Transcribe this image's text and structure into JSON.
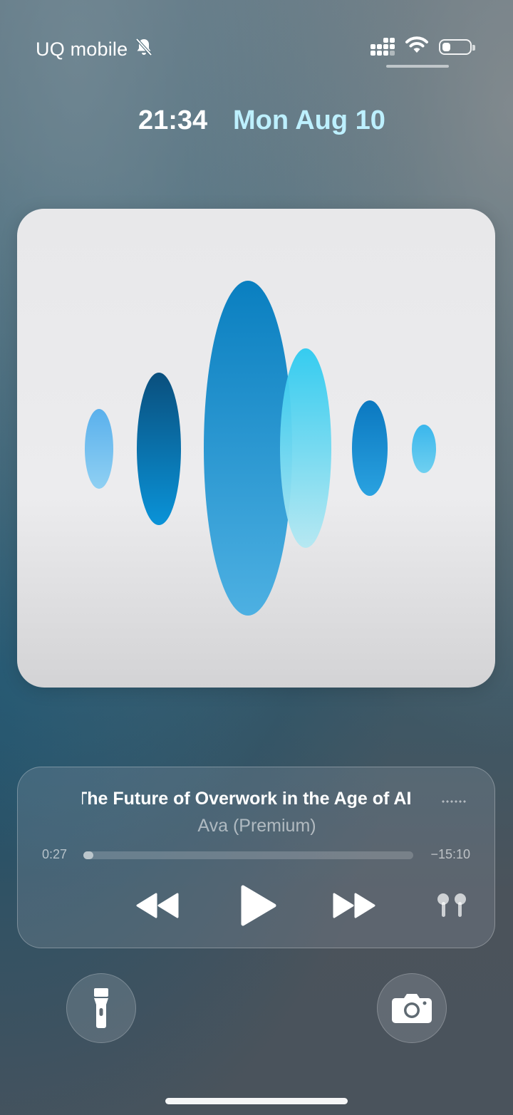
{
  "status_bar": {
    "carrier": "UQ mobile",
    "icons": [
      "bell-slash-icon",
      "signal-icon",
      "wifi-icon",
      "battery-icon"
    ],
    "battery_level": 0.3
  },
  "lock_screen": {
    "time": "21:34",
    "date": "Mon Aug 10"
  },
  "now_playing": {
    "artwork": "voice-waveform-artwork",
    "title": "The Future of Overwork in the Age of AI",
    "artist": "Ava (Premium)",
    "elapsed": "0:27",
    "remaining": "−15:10",
    "progress": 0.03,
    "controls": [
      "rewind-icon",
      "play-icon",
      "fast-forward-icon",
      "airpods-icon"
    ]
  },
  "quick_actions": {
    "left": "flashlight-icon",
    "right": "camera-icon"
  },
  "colors": {
    "date_accent": "#bdf0ff",
    "artwork_bg": "#ececee",
    "wave_dark": "#0a5a8c",
    "wave_mid": "#1d9ad8",
    "wave_light": "#5fd4f2"
  }
}
